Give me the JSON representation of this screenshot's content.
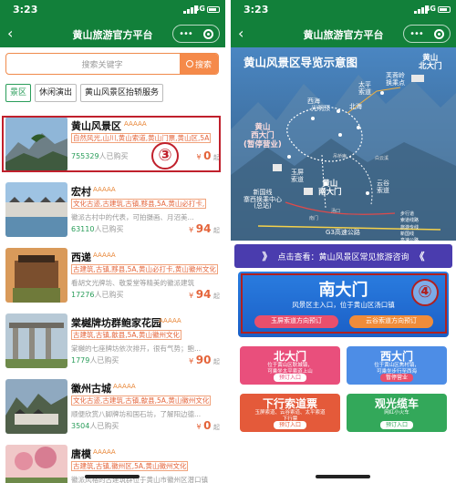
{
  "statusbar": {
    "time": "3:23",
    "network": "4G"
  },
  "titlebar": {
    "title": "黄山旅游官方平台",
    "back": "‹",
    "more": "•••"
  },
  "search": {
    "placeholder": "搜索关键字",
    "button": "搜索"
  },
  "tabs": [
    "景区",
    "休闲演出",
    "黄山风景区抬轿服务"
  ],
  "items": [
    {
      "name": "黄山风景区",
      "stars": "AAAAA",
      "tags": "自然风光,山川,黄山索道,黄山门票,黄山区,5A",
      "desc": "",
      "sold_num": "755329",
      "sold_suffix": "人已购买",
      "price_sym": "¥",
      "price": "0",
      "price_suffix": "起"
    },
    {
      "name": "宏村",
      "stars": "AAAAA",
      "tags": "文化古迹,古建筑,古镇,黟县,5A,黄山必打卡,",
      "desc": "徽派古村中的代表，可拍摄画、月沼美...",
      "sold_num": "63110",
      "sold_suffix": "人已购买",
      "price_sym": "¥",
      "price": "94",
      "price_suffix": "起"
    },
    {
      "name": "西递",
      "stars": "AAAAA",
      "tags": "古建筑,古镇,黟县,5A,黄山必打卡,黄山徽州文化",
      "desc": "看胡文光牌坊、敬爱堂等精美的徽派建筑",
      "sold_num": "17276",
      "sold_suffix": "人已购买",
      "price_sym": "¥",
      "price": "94",
      "price_suffix": "起"
    },
    {
      "name": "棠樾牌坊群鲍家花园",
      "stars": "AAAAA",
      "tags": "古建筑,古镇,歙县,5A,黄山徽州文化",
      "desc": "棠樾的七座牌坊依次排开，很有气势；鲍...",
      "sold_num": "1779",
      "sold_suffix": "人已购买",
      "price_sym": "¥",
      "price": "90",
      "price_suffix": "起"
    },
    {
      "name": "徽州古城",
      "stars": "AAAAA",
      "tags": "文化古迹,古建筑,古镇,歙县,5A,黄山徽州文化",
      "desc": "顺便欣赏八脚牌坊和国石坊，了解阳边德...",
      "sold_num": "3504",
      "sold_suffix": "人已购买",
      "price_sym": "¥",
      "price": "0",
      "price_suffix": "起"
    },
    {
      "name": "唐模",
      "stars": "AAAAA",
      "tags": "古建筑,古镇,徽州区,5A,黄山徽州文化",
      "desc": "徽派风格的古建筑群位于黄山市徽州区潜口镇",
      "sold_num": "",
      "sold_suffix": "",
      "price_sym": "",
      "price": "",
      "price_suffix": ""
    }
  ],
  "annotations": {
    "circle_left": "③",
    "circle_right": "④"
  },
  "map": {
    "title": "黄山风景区导览示意图",
    "labels": {
      "north_gate": "黄山\n北大门",
      "west_gate": "黄山\n西大门\n(暂停营业)",
      "south_gate": "黄山\n南大门",
      "transfer_center": "新国线\n寨西换乘中心\n(总站)",
      "xihai": "西海",
      "guangming": "光明顶",
      "beihai": "北海",
      "taiping": "太平\n索道",
      "furong": "芙蓉岭\n换乘点",
      "yuping": "玉屏\n索道",
      "yungu": "云谷\n索道",
      "tangkou": "汤口",
      "baiyun": "白云溪",
      "road": "G3高速公路",
      "diaoqiao": "吊桥庵",
      "gate_south": "南门"
    },
    "legend": [
      "步行道",
      "索道线路",
      "旅游专线",
      "新国线",
      "高速公路"
    ]
  },
  "faq": {
    "text": "点击查看：黄山风景区常见旅游咨询",
    "left_arrow": "》",
    "right_arrow": "《"
  },
  "nandamen": {
    "title": "南大门",
    "subtitle": "风景区主入口，位于黄山区汤口镇",
    "btn_left": "玉屏索道方向预订",
    "btn_right": "云谷索道方向预订"
  },
  "cards": [
    {
      "title": "北大门",
      "subtitle": "位于黄山区耿城镇，\n可乘坐太平索道上山",
      "button": "预订入口",
      "color": "#e94f7c"
    },
    {
      "title": "西大门",
      "subtitle": "位于黄山区焦村镇，\n可乘坐步行至西海",
      "button": "暂停营业",
      "color": "#4d8de6"
    },
    {
      "title": "下行索道票",
      "subtitle": "玉屏索道、云谷索道、太平索道\n下行票",
      "button": "预订入口",
      "color": "#e45a3a"
    },
    {
      "title": "观光缆车",
      "subtitle": "网红小火车",
      "button": "预订入口",
      "color": "#33a85a"
    }
  ],
  "colors": {
    "header_green": "#12803a",
    "accent_orange": "#f58a4a",
    "annotation_red": "#c0202c"
  }
}
